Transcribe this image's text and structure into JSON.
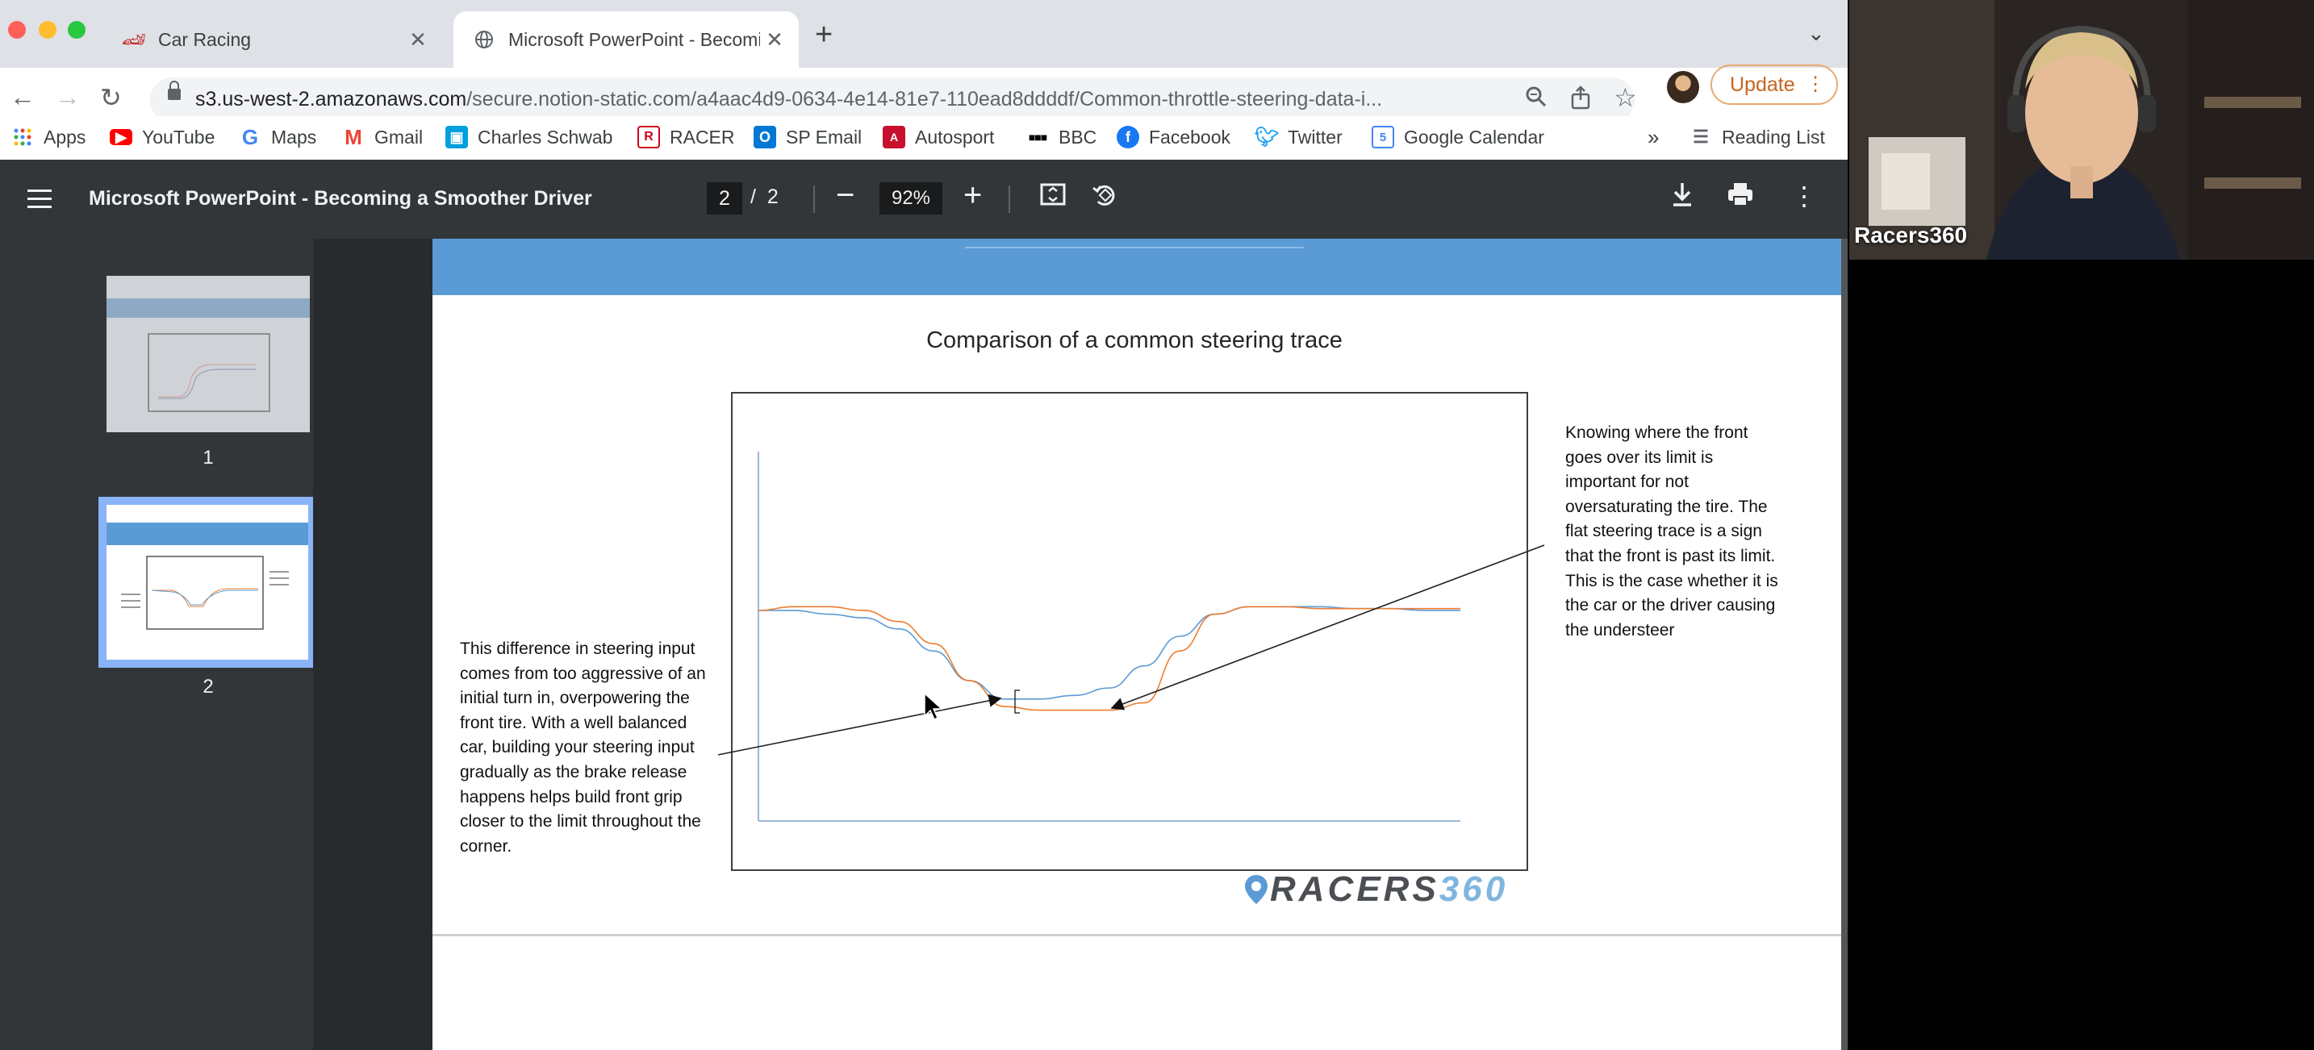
{
  "tabs": [
    {
      "title": "Car Racing",
      "icon": "car-racing-favicon"
    },
    {
      "title": "Microsoft PowerPoint - Becomi",
      "icon": "globe-icon"
    }
  ],
  "url": {
    "host": "s3.us-west-2.amazonaws.com",
    "path": "/secure.notion-static.com/a4aac4d9-0634-4e14-81e7-110ead8ddddf/Common-throttle-steering-data-i..."
  },
  "update_label": "Update",
  "bookmarks": [
    {
      "label": "Apps",
      "icon": "apps-grid-icon",
      "color": "#4285f4"
    },
    {
      "label": "YouTube",
      "icon": "youtube-icon",
      "color": "#ff0000"
    },
    {
      "label": "Maps",
      "icon": "google-g-icon",
      "color": "#4285f4"
    },
    {
      "label": "Gmail",
      "icon": "gmail-icon",
      "color": "#ea4335"
    },
    {
      "label": "Charles Schwab",
      "icon": "schwab-icon",
      "color": "#00a0df"
    },
    {
      "label": "RACER",
      "icon": "racer-icon",
      "color": "#d0021b"
    },
    {
      "label": "SP Email",
      "icon": "outlook-icon",
      "color": "#0078d4"
    },
    {
      "label": "Autosport",
      "icon": "autosport-icon",
      "color": "#c8102e"
    },
    {
      "label": "BBC",
      "icon": "bbc-icon",
      "color": "#000000"
    },
    {
      "label": "Facebook",
      "icon": "facebook-icon",
      "color": "#1877f2"
    },
    {
      "label": "Twitter",
      "icon": "twitter-icon",
      "color": "#1da1f2"
    },
    {
      "label": "Google Calendar",
      "icon": "calendar-icon",
      "color": "#4285f4"
    }
  ],
  "bookmarks_overflow": "»",
  "reading_list": "Reading List",
  "pdf": {
    "title": "Microsoft PowerPoint - Becoming a Smoother Driver",
    "current_page": "2",
    "total_pages": "2",
    "page_separator": "/",
    "zoom": "92%",
    "thumbnails": [
      {
        "number": "1",
        "selected": false
      },
      {
        "number": "2",
        "selected": true
      }
    ]
  },
  "slide": {
    "title": "Comparison of a common steering trace",
    "left_note": "This difference in steering input comes from too aggressive of an initial turn in, overpowering the front tire. With a well balanced car, building your steering input gradually as the brake release happens helps build front grip closer to the limit throughout the corner.",
    "right_note": "Knowing where the front goes over its limit is important for not oversaturating the tire. The flat steering trace is a sign that the front is past its limit. This is the case whether it is the car or the driver causing the understeer",
    "brand_name": "RACERS",
    "brand_number": "360"
  },
  "chart_data": {
    "type": "line",
    "title": "Comparison of a common steering trace",
    "xlabel": "",
    "ylabel": "",
    "grid": false,
    "legend": "none",
    "x": [
      0,
      0.05,
      0.1,
      0.15,
      0.2,
      0.25,
      0.3,
      0.35,
      0.4,
      0.45,
      0.5,
      0.55,
      0.6,
      0.65,
      0.7,
      0.75,
      0.8,
      0.85,
      0.9,
      0.95,
      1.0
    ],
    "series": [
      {
        "color": "#5b9bd5",
        "values": [
          0.57,
          0.57,
          0.56,
          0.55,
          0.52,
          0.46,
          0.38,
          0.33,
          0.33,
          0.34,
          0.36,
          0.42,
          0.5,
          0.56,
          0.58,
          0.58,
          0.58,
          0.575,
          0.575,
          0.57,
          0.57
        ]
      },
      {
        "color": "#ed7d31",
        "values": [
          0.57,
          0.58,
          0.58,
          0.57,
          0.54,
          0.48,
          0.38,
          0.31,
          0.3,
          0.3,
          0.3,
          0.32,
          0.46,
          0.56,
          0.58,
          0.58,
          0.575,
          0.575,
          0.575,
          0.575,
          0.575
        ]
      }
    ]
  },
  "presenter_name": "Racers360"
}
